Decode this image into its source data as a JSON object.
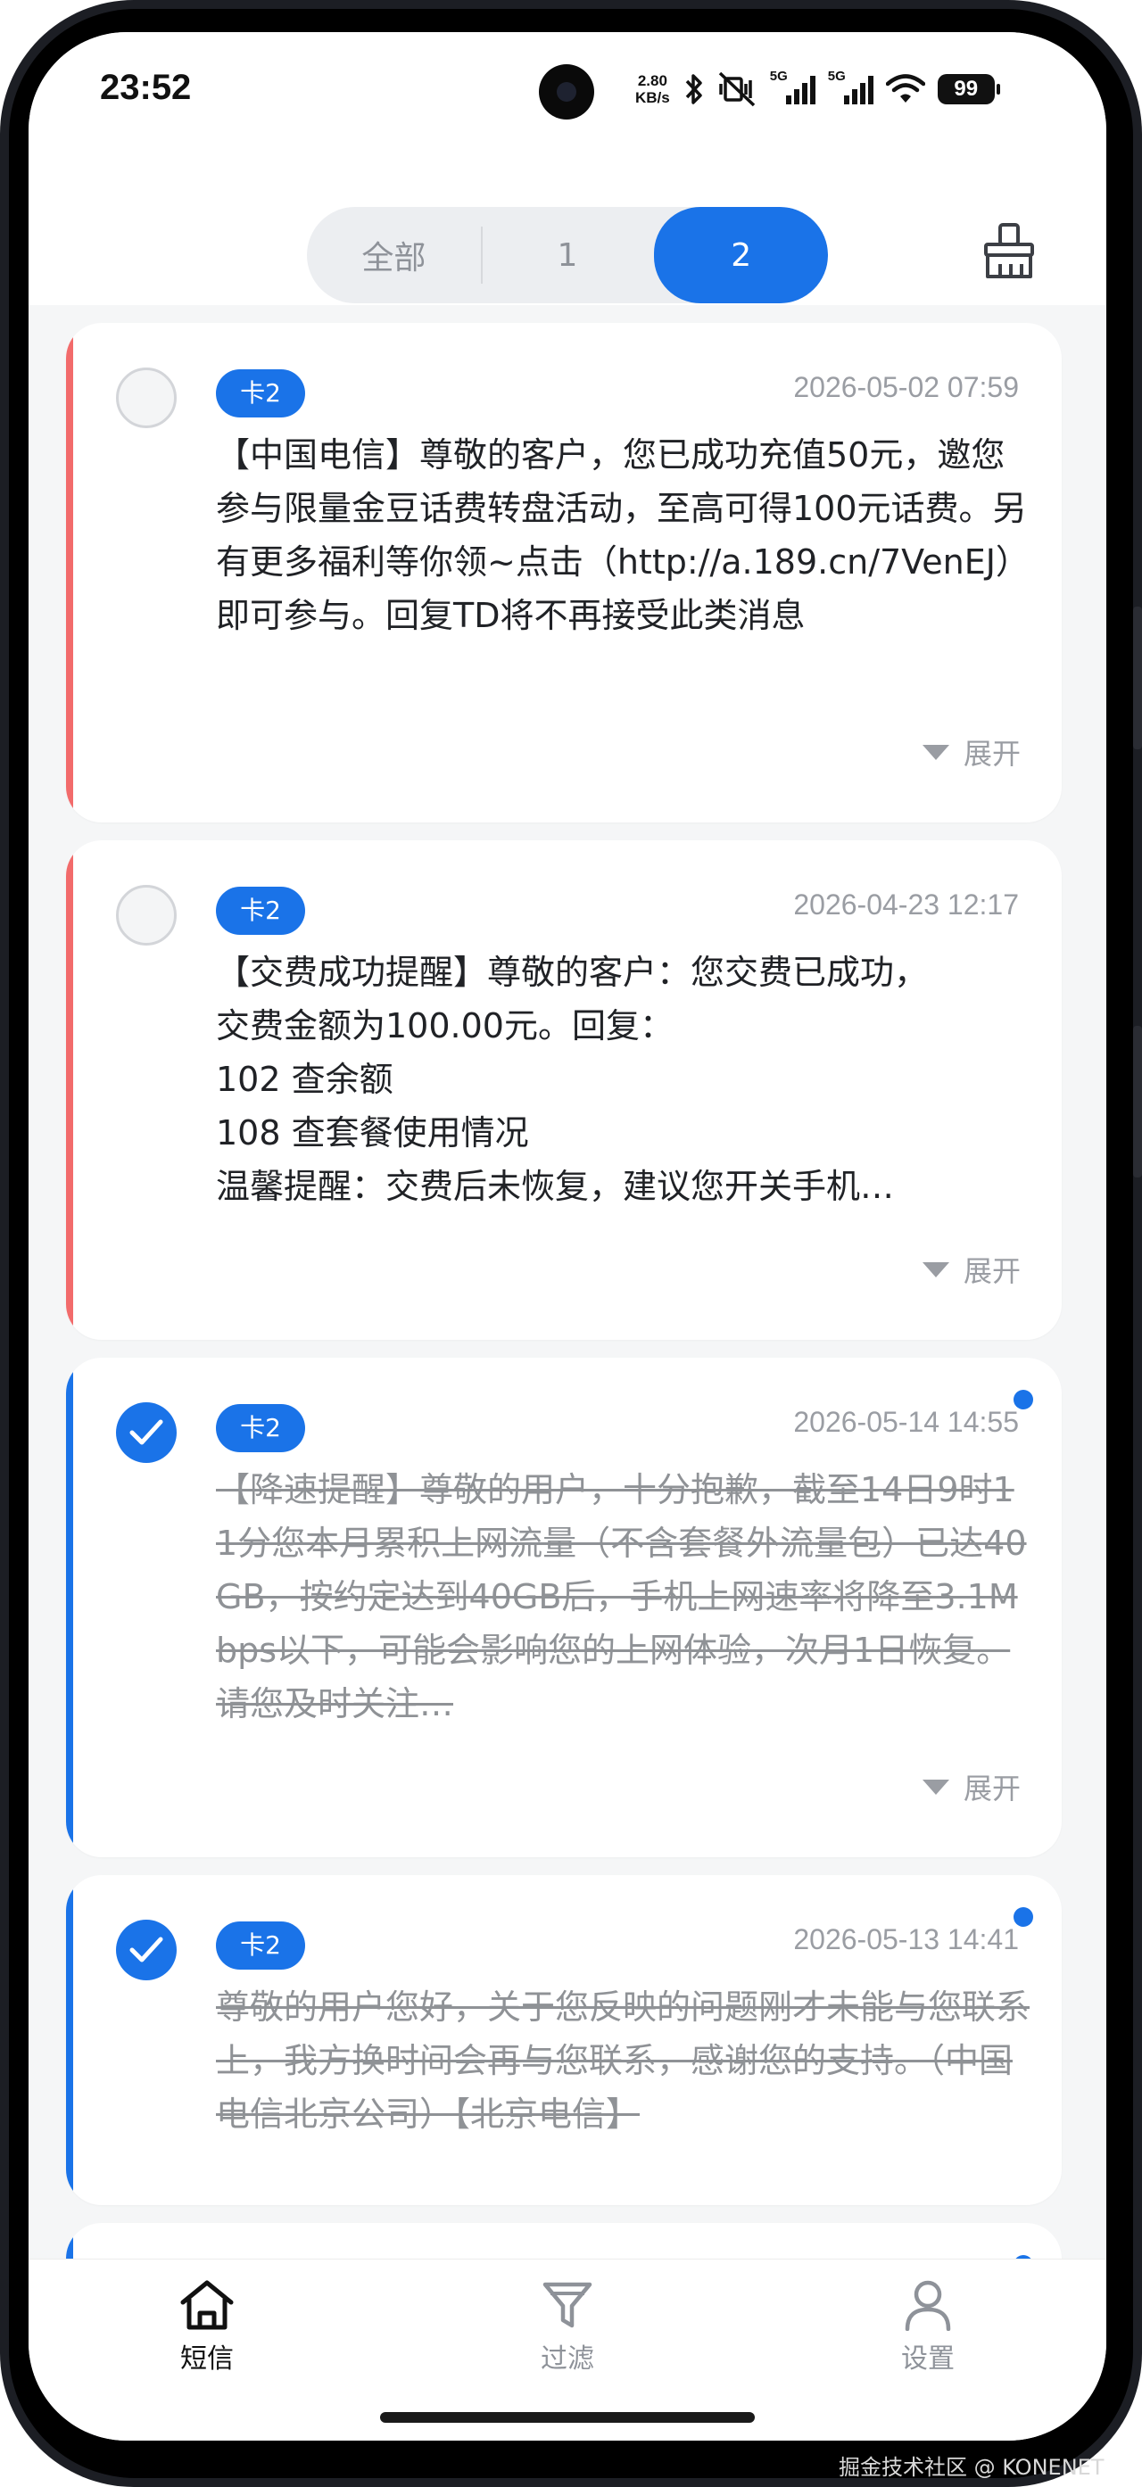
{
  "status": {
    "time": "23:52",
    "net_speed_value": "2.80",
    "net_speed_unit": "KB/s",
    "sim1_type": "5G",
    "sim2_type": "5G",
    "battery": "99",
    "icons": [
      "bluetooth-icon",
      "mute-vibrate-icon",
      "signal-icon",
      "wifi-icon",
      "battery-icon"
    ]
  },
  "header": {
    "tabs": [
      {
        "label": "全部",
        "selected": false
      },
      {
        "label": "1",
        "selected": false
      },
      {
        "label": "2",
        "selected": true
      }
    ],
    "clear_icon": "broom-icon"
  },
  "messages": [
    {
      "sim": "卡2",
      "date": "2026-05-02 07:59",
      "checked": false,
      "unread": false,
      "accent": "#f26b6b",
      "body": "【中国电信】尊敬的客户，您已成功充值50元，邀您参与限量金豆话费转盘活动，至高可得100元话费。另有更多福利等你领~点击（http://a.189.cn/7VenEJ）即可参与。回复TD将不再接受此类消息",
      "expand": "展开"
    },
    {
      "sim": "卡2",
      "date": "2026-04-23 12:17",
      "checked": false,
      "unread": false,
      "accent": "#f26b6b",
      "body": "【交费成功提醒】尊敬的客户：您交费已成功，\n交费金额为100.00元。回复：\n102 查余额\n108 查套餐使用情况\n温馨提醒：交费后未恢复，建议您开关手机…",
      "expand": "展开"
    },
    {
      "sim": "卡2",
      "date": "2026-05-14 14:55",
      "checked": true,
      "unread": true,
      "accent": "#1a73e8",
      "body": "【降速提醒】尊敬的用户，十分抱歉，截至14日9时11分您本月累积上网流量（不含套餐外流量包）已达40GB，按约定达到40GB后，手机上网速率将降至3.1Mbps以下，可能会影响您的上网体验，次月1日恢复。请您及时关注…",
      "expand": "展开"
    },
    {
      "sim": "卡2",
      "date": "2026-05-13 14:41",
      "checked": true,
      "unread": true,
      "accent": "#1a73e8",
      "body": "尊敬的用户您好，关于您反映的问题刚才未能与您联系上，我方换时间会再与您联系，感谢您的支持。（中国电信北京公司）【北京电信】",
      "expand": ""
    }
  ],
  "nav": [
    {
      "label": "短信",
      "icon": "home-icon",
      "active": true
    },
    {
      "label": "过滤",
      "icon": "filter-icon",
      "active": false
    },
    {
      "label": "设置",
      "icon": "person-icon",
      "active": false
    }
  ],
  "colors": {
    "accent": "#1a73e8",
    "alert": "#f26b6b",
    "read_text": "#8f9296"
  },
  "watermark": "掘金技术社区 @ KONENET"
}
